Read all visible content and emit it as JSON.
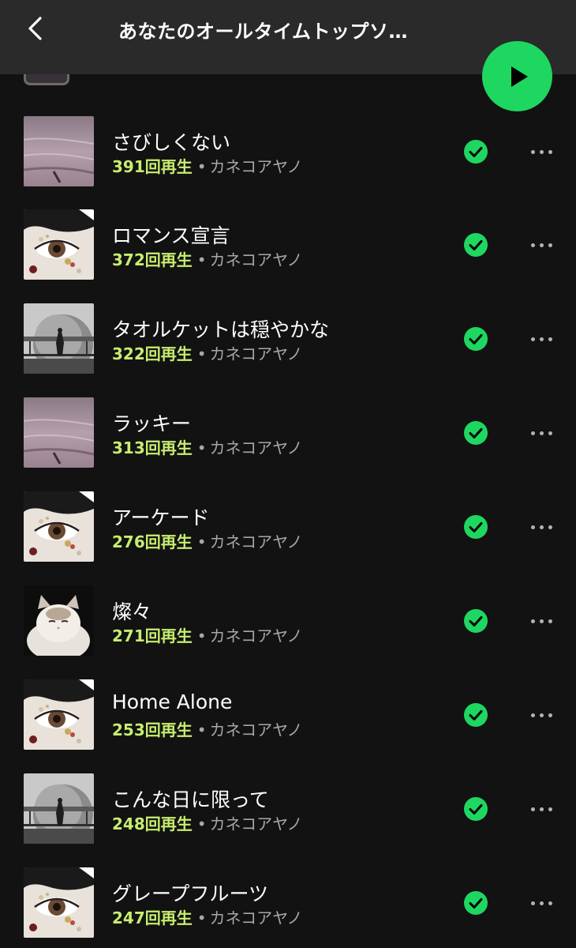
{
  "header": {
    "title": "あなたのオールタイムトップソ…",
    "back_icon": "chevron-left-icon",
    "play_icon": "play-icon"
  },
  "colors": {
    "background": "#121212",
    "header": "#2a2a2a",
    "accent_green": "#1ed760",
    "plays_green": "#c7ee6e",
    "subtext": "#a7a7a7"
  },
  "tracks": [
    {
      "title": "さびしくない",
      "plays": "391回再生",
      "separator": "•",
      "artist": "カネコアヤノ",
      "art": "pink-sea",
      "downloaded": true
    },
    {
      "title": "ロマンス宣言",
      "plays": "372回再生",
      "separator": "•",
      "artist": "カネコアヤノ",
      "art": "eye-closeup",
      "downloaded": true
    },
    {
      "title": "タオルケットは穏やかな",
      "plays": "322回再生",
      "separator": "•",
      "artist": "カネコアヤノ",
      "art": "dome-figure",
      "downloaded": true
    },
    {
      "title": "ラッキー",
      "plays": "313回再生",
      "separator": "•",
      "artist": "カネコアヤノ",
      "art": "pink-sea",
      "downloaded": true
    },
    {
      "title": "アーケード",
      "plays": "276回再生",
      "separator": "•",
      "artist": "カネコアヤノ",
      "art": "eye-closeup",
      "downloaded": true
    },
    {
      "title": "燦々",
      "plays": "271回再生",
      "separator": "•",
      "artist": "カネコアヤノ",
      "art": "cat",
      "downloaded": true
    },
    {
      "title": "Home Alone",
      "plays": "253回再生",
      "separator": "•",
      "artist": "カネコアヤノ",
      "art": "eye-closeup",
      "downloaded": true
    },
    {
      "title": "こんな日に限って",
      "plays": "248回再生",
      "separator": "•",
      "artist": "カネコアヤノ",
      "art": "dome-figure",
      "downloaded": true
    },
    {
      "title": "グレープフルーツ",
      "plays": "247回再生",
      "separator": "•",
      "artist": "カネコアヤノ",
      "art": "eye-closeup",
      "downloaded": true
    }
  ]
}
